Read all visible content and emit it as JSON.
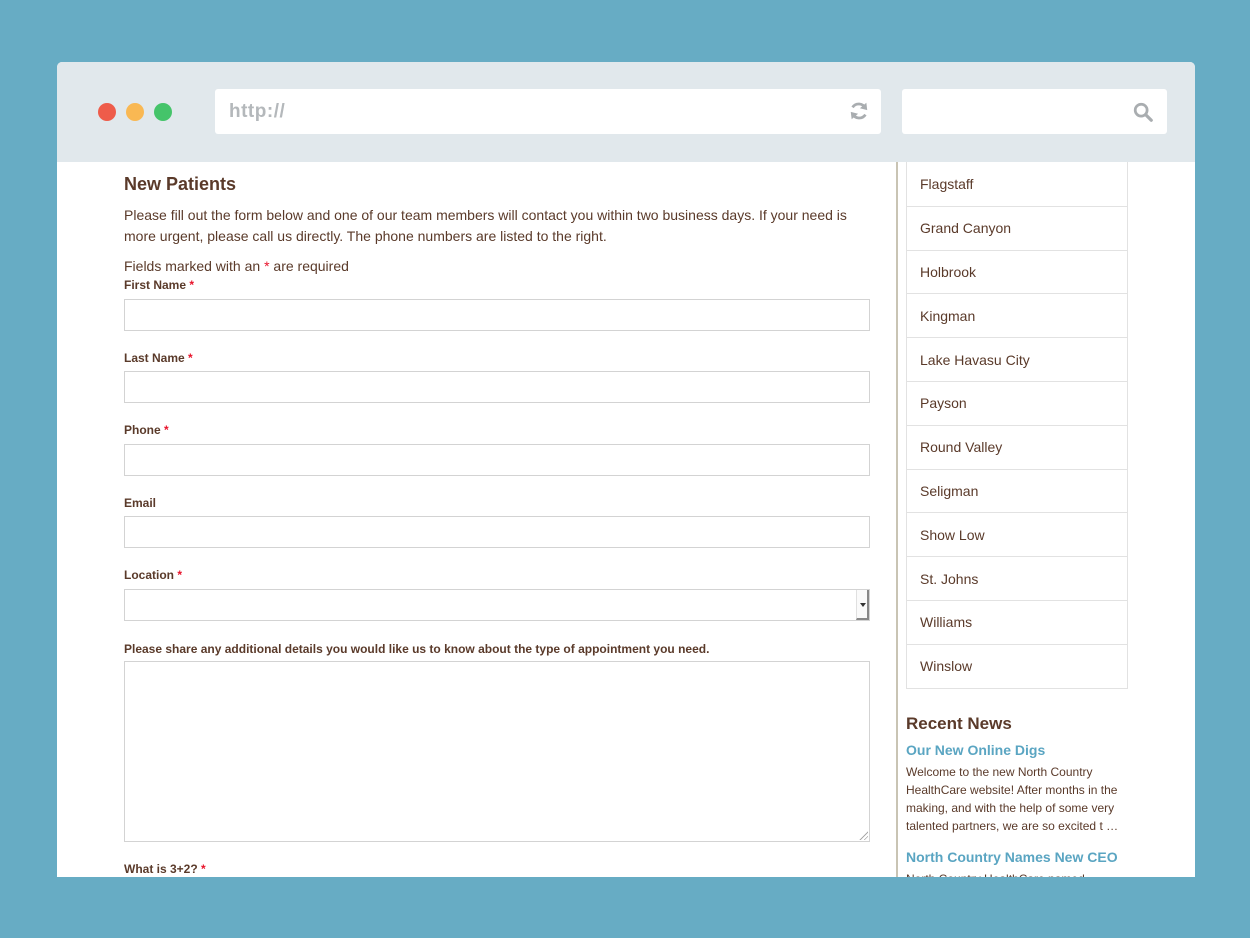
{
  "browser": {
    "url_placeholder": "http://",
    "search_value": "",
    "icons": {
      "reload": "reload-icon",
      "search": "search-icon"
    },
    "traffic_lights": [
      "close",
      "minimize",
      "maximize"
    ]
  },
  "form": {
    "title": "New Patients",
    "intro": "Please fill out the form below and one of our team members will contact you within two business days. If your need is more urgent, please call us directly. The phone numbers are listed to the right.",
    "required_note_prefix": "Fields marked with an ",
    "required_star": "*",
    "required_note_suffix": " are required",
    "fields": {
      "first_name": {
        "label": "First Name",
        "value": ""
      },
      "last_name": {
        "label": "Last Name",
        "value": ""
      },
      "phone": {
        "label": "Phone",
        "value": ""
      },
      "email": {
        "label": "Email",
        "value": ""
      },
      "location": {
        "label": "Location",
        "selected": ""
      },
      "details": {
        "label": "Please share any additional details you would like us to know about the type of appointment you need.",
        "value": ""
      },
      "captcha": {
        "label": "What is 3+2?"
      }
    }
  },
  "sidebar": {
    "locations": [
      "Flagstaff",
      "Grand Canyon",
      "Holbrook",
      "Kingman",
      "Lake Havasu City",
      "Payson",
      "Round Valley",
      "Seligman",
      "Show Low",
      "St. Johns",
      "Williams",
      "Winslow"
    ],
    "news": {
      "heading": "Recent News",
      "items": [
        {
          "title": "Our New Online Digs",
          "excerpt_lines": [
            "Welcome to the new North Country",
            "HealthCare website! After months in the",
            "making, and with the help of some very",
            "talented partners, we are so excited t …"
          ]
        },
        {
          "title": "North Country Names New CEO",
          "excerpt_lines": [
            "North Country HealthCare named"
          ]
        }
      ]
    }
  },
  "colors": {
    "text": "#5a3a2a",
    "link": "#5aa5c2",
    "required": "#e8132b",
    "background": "#67acc4",
    "chrome": "#e1e8ec"
  }
}
